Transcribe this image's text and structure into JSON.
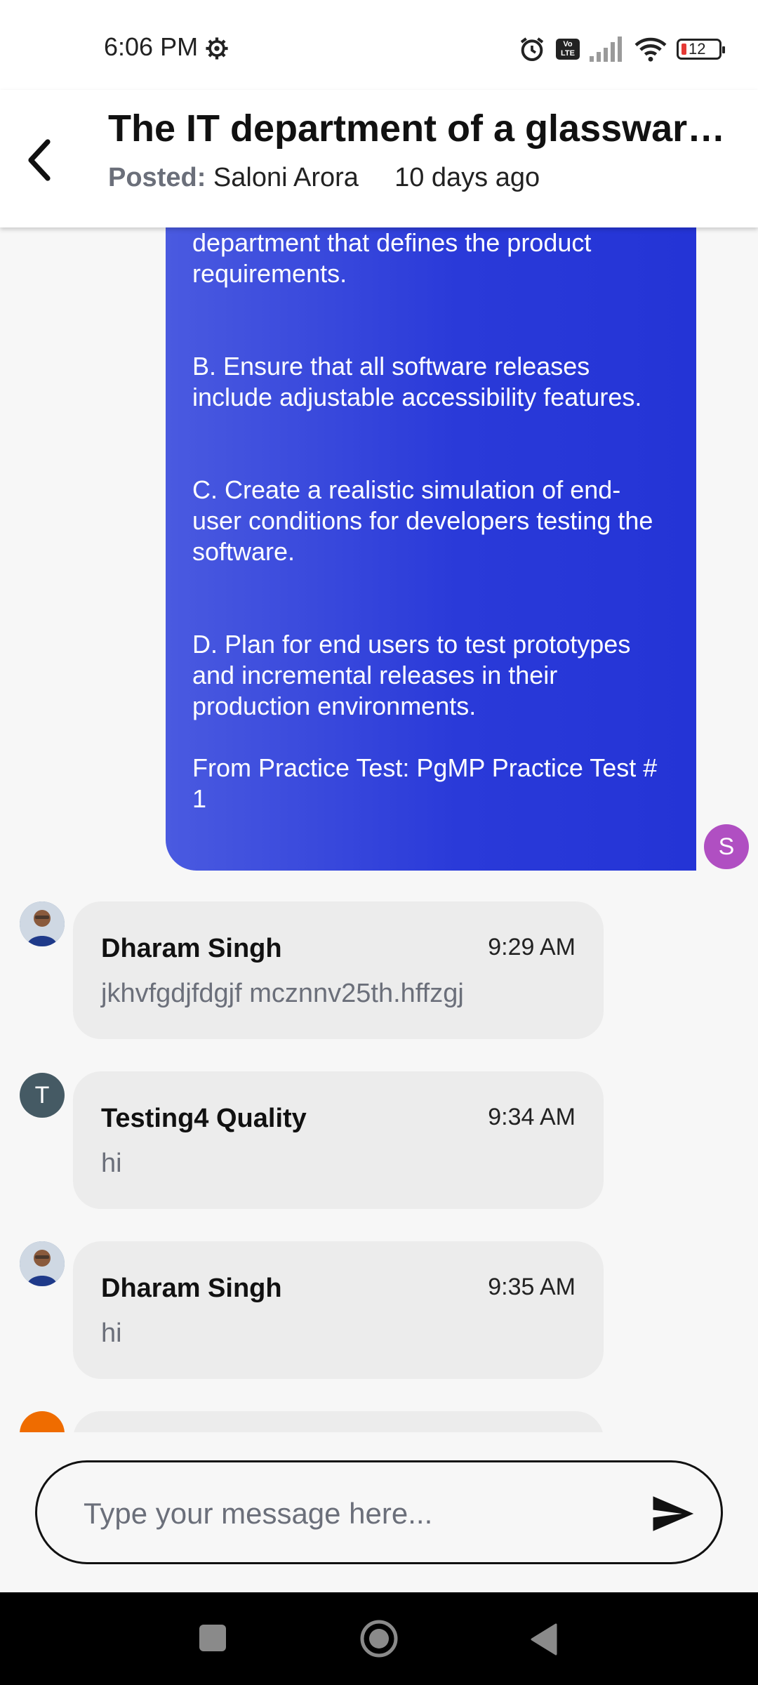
{
  "status_bar": {
    "time": "6:06 PM",
    "battery": "12",
    "icons": [
      "gear-icon",
      "alarm-icon",
      "volte-icon",
      "signal-icon",
      "wifi-icon",
      "battery-icon"
    ]
  },
  "header": {
    "title": "The IT department of a glassware ...",
    "posted_label": "Posted:",
    "author": "Saloni Arora",
    "age": "10 days ago"
  },
  "question_bubble": {
    "lines": [
      "department that defines the product requirements.",
      "B.  Ensure that all software releases include adjustable accessibility features.",
      "C.  Create a realistic simulation of end-user conditions for developers testing the software.",
      "D.  Plan for end users to test prototypes and incremental releases in their production environments.",
      "From Practice Test: PgMP Practice Test # 1"
    ],
    "sender_initial": "S",
    "avatar_color": "#b04fc2",
    "bubble_color": "#2f3fdc"
  },
  "messages": [
    {
      "name": "Dharam Singh",
      "time": "9:29 AM",
      "text": "jkhvfgdjfdgjf mcznnv25th.hffzgj",
      "avatar": "photo"
    },
    {
      "name": "Testing4 Quality",
      "time": "9:34 AM",
      "text": "hi",
      "avatar": "T"
    },
    {
      "name": "Dharam Singh",
      "time": "9:35 AM",
      "text": "hi",
      "avatar": "photo"
    }
  ],
  "composer": {
    "placeholder": "Type your message here..."
  }
}
